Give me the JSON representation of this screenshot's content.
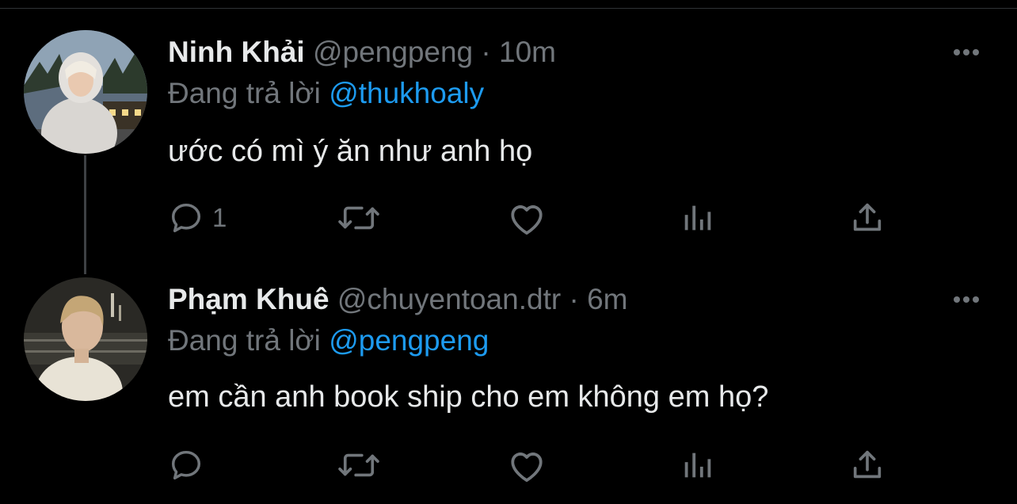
{
  "colors": {
    "background": "#000000",
    "primary_text": "#e7e9ea",
    "secondary_text": "#71767b",
    "accent": "#1d9bf0",
    "thread_line": "#3e4144"
  },
  "tweets": [
    {
      "name": "Ninh Khải",
      "handle": "@pengpeng",
      "separator": "·",
      "time": "10m",
      "reply_prefix": "Đang trả lời",
      "reply_to": "@thukhoaly",
      "text": "ước có mì ý ăn như anh họ",
      "reply_count": "1",
      "icons": [
        "more-icon",
        "reply-icon",
        "retweet-icon",
        "like-icon",
        "views-icon",
        "share-icon"
      ]
    },
    {
      "name": "Phạm Khuê",
      "handle": "@chuyentoan.dtr",
      "separator": "·",
      "time": "6m",
      "reply_prefix": "Đang trả lời",
      "reply_to": "@pengpeng",
      "text": "em cần anh book ship cho em không em họ?",
      "reply_count": "",
      "icons": [
        "more-icon",
        "reply-icon",
        "retweet-icon",
        "like-icon",
        "views-icon",
        "share-icon"
      ]
    }
  ]
}
